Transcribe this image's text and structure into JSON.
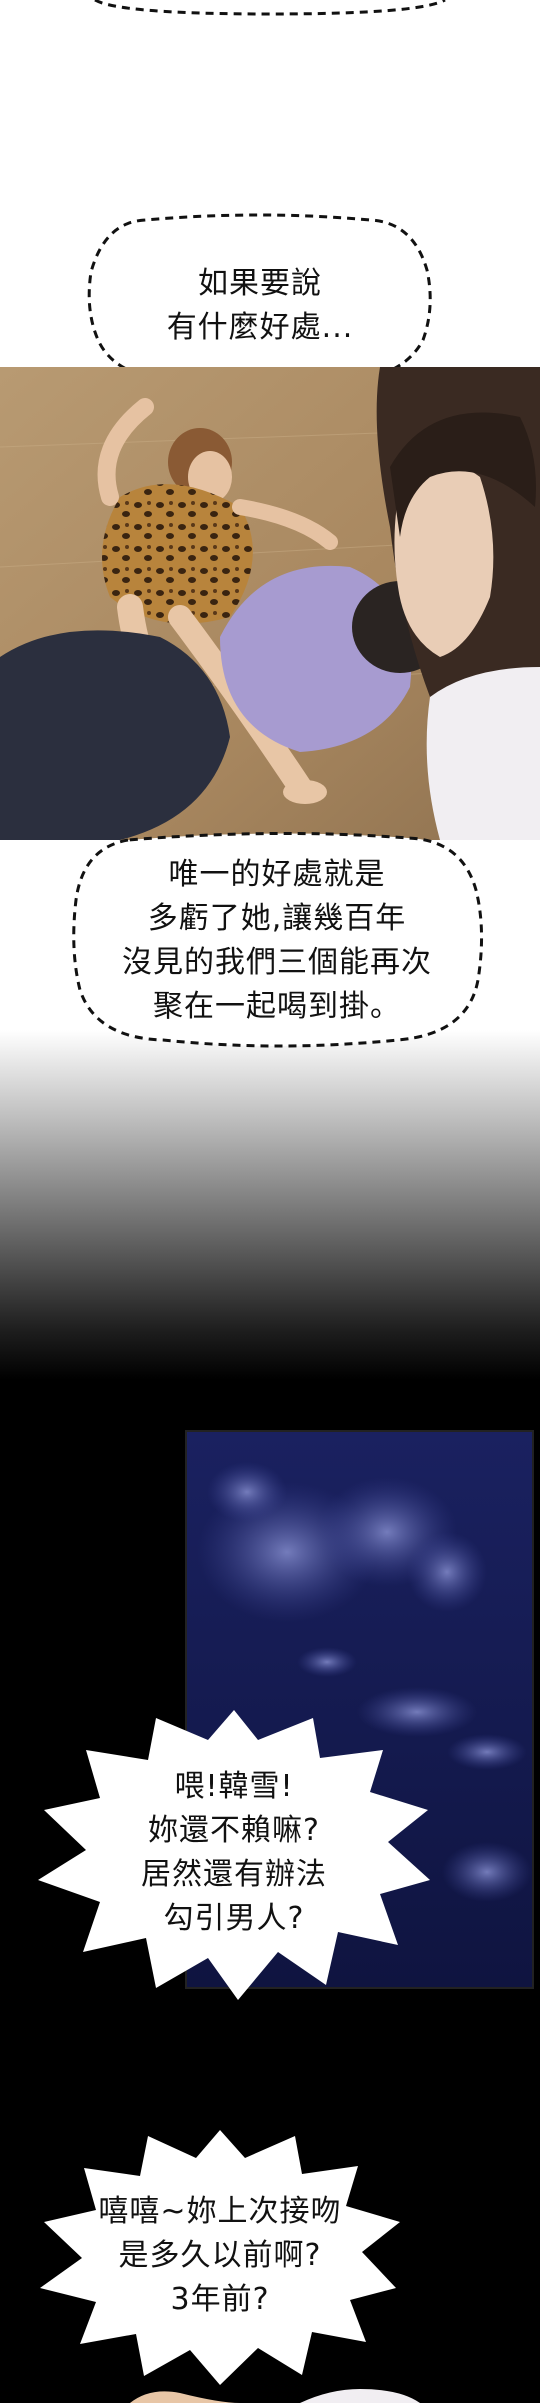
{
  "bubbles": {
    "bubble_1": {
      "lines": [
        "如果要說",
        "有什麼好處..."
      ]
    },
    "bubble_2": {
      "lines": [
        "唯一的好處就是",
        "多虧了她,讓幾百年",
        "沒見的我們三個能再次",
        "聚在一起喝到掛。"
      ]
    },
    "bubble_3": {
      "lines": [
        "喂!韓雪!",
        "妳還不賴嘛?",
        "居然還有辦法",
        "勾引男人?"
      ]
    },
    "bubble_4": {
      "lines": [
        "嘻嘻~妳上次接吻",
        "是多久以前啊?",
        "3年前?"
      ]
    }
  },
  "colors": {
    "bubble_fill": "#ffffff",
    "bubble_outline": "#111111",
    "night_sky": "#141a48"
  }
}
